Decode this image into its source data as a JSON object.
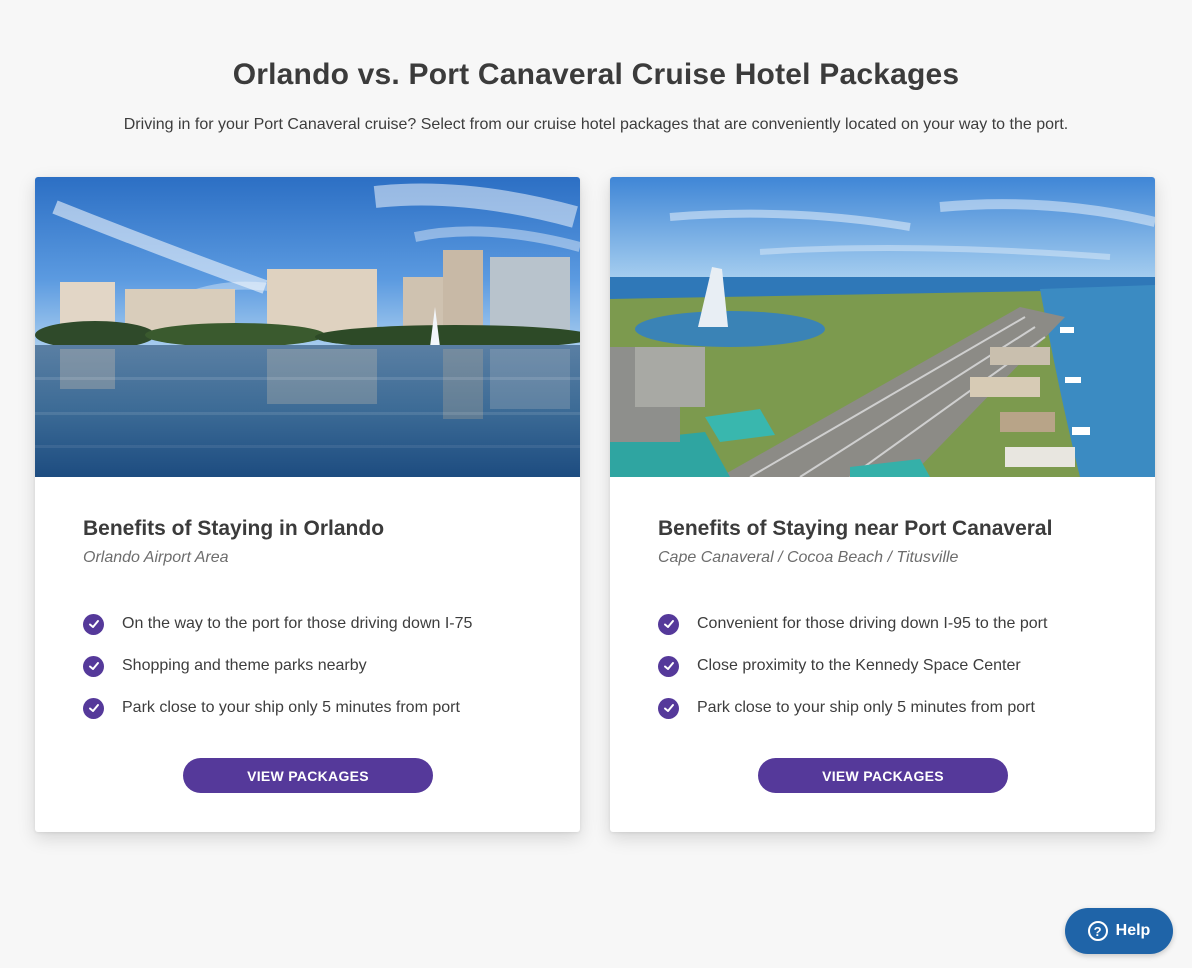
{
  "header": {
    "title": "Orlando vs. Port Canaveral Cruise Hotel Packages",
    "subtitle": "Driving in for your Port Canaveral cruise? Select from our cruise hotel packages that are conveniently located on your way to the port."
  },
  "cards": [
    {
      "image_icon": "orlando-skyline-lake-photo",
      "title": "Benefits of Staying in Orlando",
      "subtitle": "Orlando Airport Area",
      "benefits": [
        "On the way to the port for those driving down I-75",
        "Shopping and theme parks nearby",
        "Park close to your ship only 5 minutes from port"
      ],
      "button_label": "VIEW PACKAGES"
    },
    {
      "image_icon": "port-canaveral-aerial-photo",
      "title": "Benefits of Staying near Port Canaveral",
      "subtitle": "Cape Canaveral / Cocoa Beach / Titusville",
      "benefits": [
        "Convenient for those driving down I-95 to the port",
        "Close proximity to the Kennedy Space Center",
        "Park close to your ship only 5 minutes from port"
      ],
      "button_label": "VIEW PACKAGES"
    }
  ],
  "help_widget": {
    "label": "Help",
    "icon": "question-circle-icon"
  },
  "colors": {
    "accent": "#55399a",
    "help": "#1f64a8",
    "background": "#f7f7f7"
  }
}
